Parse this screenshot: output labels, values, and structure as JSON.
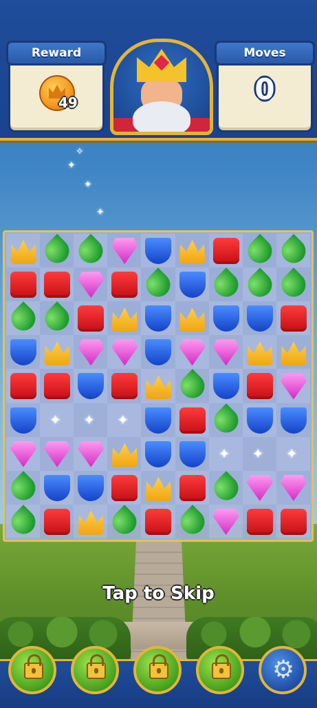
{
  "header": {
    "reward_label": "Reward",
    "reward_count": "49",
    "moves_label": "Moves",
    "moves_count": "0"
  },
  "board": {
    "rows": [
      [
        "crown",
        "leaf",
        "leaf",
        "gem",
        "shield",
        "crown",
        "box",
        "leaf",
        "leaf"
      ],
      [
        "box",
        "box",
        "gem",
        "box",
        "leaf",
        "shield",
        "leaf",
        "leaf",
        "leaf"
      ],
      [
        "leaf",
        "leaf",
        "box",
        "crown",
        "shield",
        "crown",
        "shield",
        "shield",
        "box"
      ],
      [
        "shield",
        "crown",
        "gem",
        "gem",
        "shield",
        "gem",
        "gem",
        "crown",
        "crown"
      ],
      [
        "box",
        "box",
        "shield",
        "box",
        "crown",
        "leaf",
        "shield",
        "box",
        "gem"
      ],
      [
        "shield",
        "",
        "",
        "",
        "shield",
        "box",
        "leaf",
        "shield",
        "shield"
      ],
      [
        "gem",
        "gem",
        "gem",
        "crown",
        "shield",
        "shield",
        "",
        "",
        ""
      ],
      [
        "leaf",
        "shield",
        "shield",
        "box",
        "crown",
        "box",
        "leaf",
        "gem",
        "gem"
      ],
      [
        "leaf",
        "box",
        "crown",
        "leaf",
        "box",
        "leaf",
        "gem",
        "box",
        "box"
      ]
    ]
  },
  "overlay": {
    "tap_to_skip": "Tap to Skip"
  },
  "bottom_bar": {
    "boosters": [
      "lock-icon",
      "lock-icon",
      "lock-icon",
      "lock-icon"
    ],
    "settings_icon": "gear-icon",
    "settings_glyph": "⚙"
  },
  "colors": {
    "panel_blue": "#1f4d9b",
    "gold_border": "#e2b53a",
    "crown": "#f4c22a",
    "leaf": "#1f9c2e",
    "gem": "#d32bc6",
    "shield": "#1443c8",
    "box": "#c40f14"
  }
}
